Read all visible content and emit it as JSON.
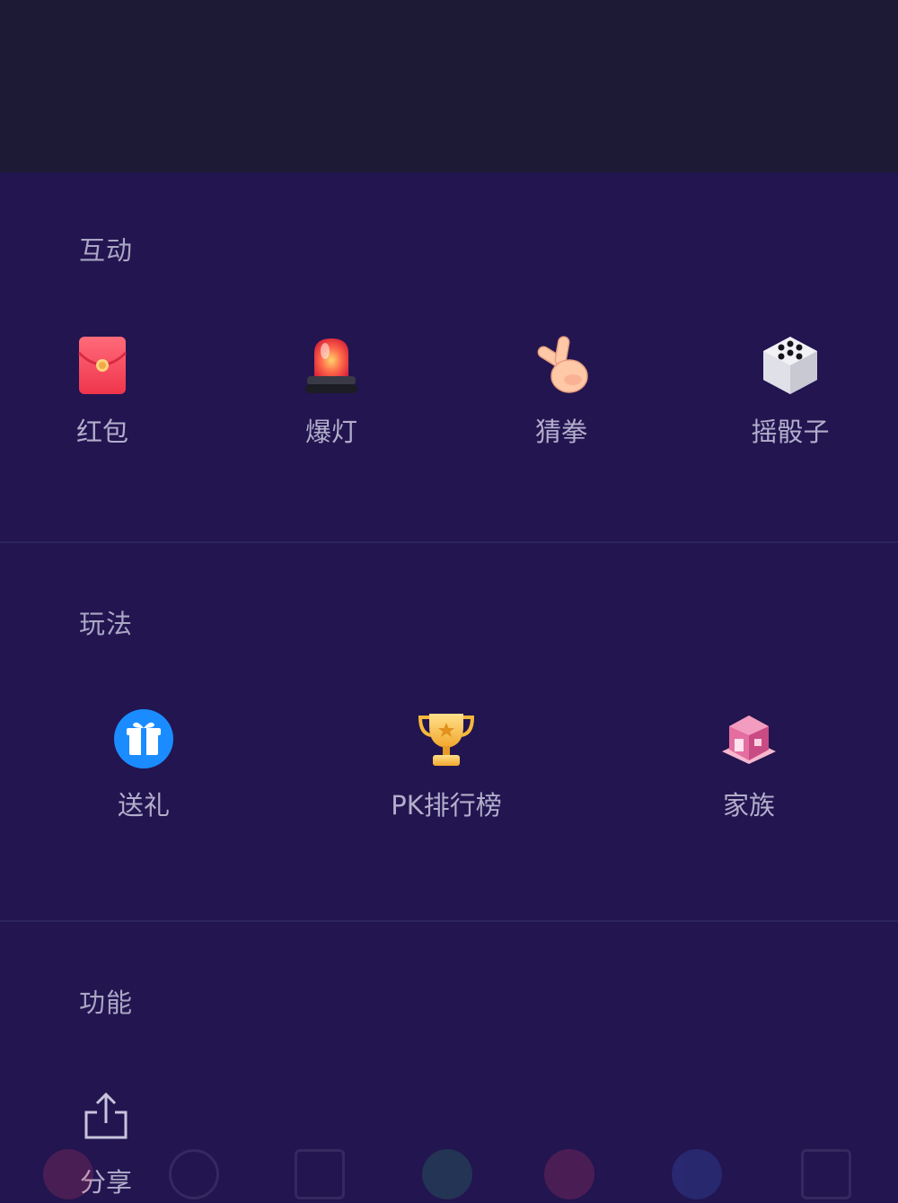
{
  "sections": [
    {
      "title": "互动",
      "items": [
        {
          "label": "红包",
          "icon": "red-envelope-icon"
        },
        {
          "label": "爆灯",
          "icon": "siren-lamp-icon"
        },
        {
          "label": "猜拳",
          "icon": "victory-hand-icon"
        },
        {
          "label": "摇骰子",
          "icon": "dice-icon"
        }
      ]
    },
    {
      "title": "玩法",
      "items": [
        {
          "label": "送礼",
          "icon": "gift-icon"
        },
        {
          "label": "PK排行榜",
          "icon": "trophy-icon"
        },
        {
          "label": "家族",
          "icon": "family-house-icon"
        }
      ]
    },
    {
      "title": "功能",
      "items": [
        {
          "label": "分享",
          "icon": "share-icon"
        }
      ]
    }
  ],
  "colors": {
    "sheet_background": "#221550",
    "backdrop": "#1d1a36",
    "section_title": "#aaa6c4",
    "item_label": "#b3aecb"
  }
}
